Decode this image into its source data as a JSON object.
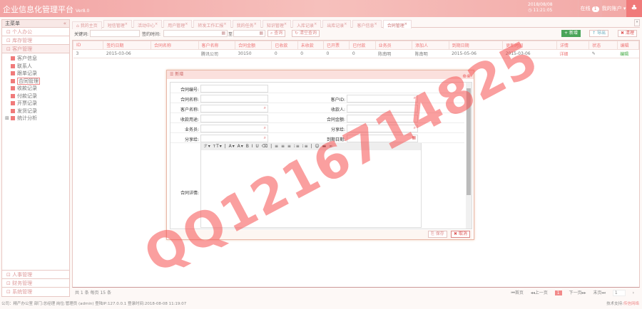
{
  "header": {
    "title": "企业信息化管理平台",
    "version": "Ver8.0",
    "date": "2018/08/08",
    "time": "11:21:05",
    "online_label": "在线",
    "online_count": "1",
    "account_label": "我的账户"
  },
  "sidebar": {
    "title": "主菜单",
    "collapse": "«",
    "top_sections": [
      "个人办公",
      "库存管理",
      "客户管理"
    ],
    "tree": [
      "客户信息",
      "联系人",
      "跟单记录",
      "合同管理",
      "收款记录",
      "付款记录",
      "开票记录",
      "发货记录",
      "统计分析"
    ],
    "bottom_sections": [
      "人事管理",
      "财务管理",
      "系统管理"
    ]
  },
  "tabs": [
    "我的主页",
    "短信管理",
    "活动中心",
    "用户管理",
    "转发工作汇报",
    "我的任务",
    "知识管理",
    "入库记录",
    "出库记录",
    "客户信息",
    "合同管理"
  ],
  "search": {
    "keyword_label": "关键词:",
    "date_label": "签约时间:",
    "to": "至",
    "query": "查询",
    "clear": "清空查询",
    "add": "新增",
    "export": "导出",
    "delete": "清理"
  },
  "table": {
    "headers": [
      "ID",
      "签约日期",
      "合同名称",
      "客户名称",
      "合同金额",
      "已收款",
      "未收款",
      "已开票",
      "已付款",
      "业务员",
      "添加人",
      "到期日期",
      "更新时间",
      "详情",
      "状态",
      "编辑"
    ],
    "rows": [
      [
        "3",
        "2015-03-06",
        "",
        "腾讯公司",
        "30150",
        "0",
        "0",
        "0",
        "0",
        "陈南明",
        "陈南明",
        "2015-05-06",
        "2015-03-06",
        "详细",
        "",
        "编辑"
      ]
    ]
  },
  "pager": {
    "summary": "共 1 条 每页 15 条",
    "first": "首页",
    "prev": "上一页",
    "current": "1",
    "next": "下一页",
    "last": "末页",
    "page_input": "1"
  },
  "dialog": {
    "title": "新增",
    "left_fields": [
      "合同编号:",
      "合同名称:",
      "客户名称:",
      "收款用途:",
      "业务员:",
      "分享给:"
    ],
    "right_fields": [
      "客户ID:",
      "收款人:",
      "合同金额:",
      "分享给:",
      "到期日期:"
    ],
    "detail_label": "合同详情:",
    "save": "保存",
    "cancel": "取消",
    "toolbar": "ℱ▾ ᴛT▾ | A▾ A▾ B I U ⌫ | ≡ ≡ ≡ ⁝≡ ⁝≡ | ☺ ▬ ∞"
  },
  "status": {
    "text": "公司：精产办公室 部门:总经理 岗位:管理员 (admin) 登陆IP:127.0.0.1 登录时间:2018-08-08 11:19:07",
    "support_label": "技术支持:",
    "support_name": "传信网络"
  },
  "watermark": "QQ1216714825"
}
